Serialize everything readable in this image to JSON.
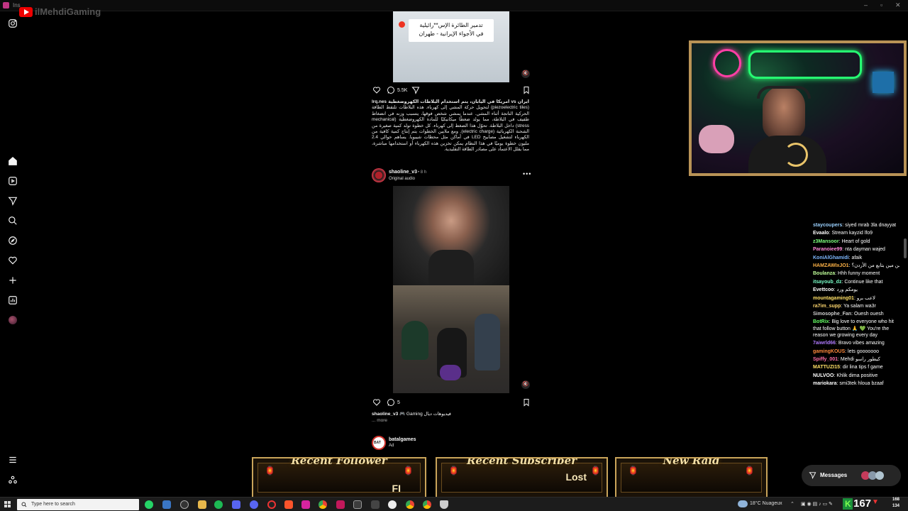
{
  "window": {
    "tab_title": "Ins"
  },
  "stream_badge": {
    "channel": "ilMehdiGaming"
  },
  "sidebar": {
    "icons": [
      "instagram-icon",
      "home-icon",
      "reels-icon",
      "send-icon",
      "search-icon",
      "explore-icon",
      "heart-icon",
      "create-icon",
      "dashboard-icon",
      "profile-icon",
      "menu-icon",
      "threads-icon"
    ]
  },
  "post1": {
    "image_text_line1": "تدمير الطائرة الإس**رائيلية",
    "image_text_line2": "في الأجواء الإيرانية - طهران",
    "comments": "5.5K",
    "caption_head": "ايران vs امريكا في اليابان، يتم استخدام البلاطات الكهروضغطية lrq.nes",
    "caption_body": "(piezoelectric tiles) لتحويل حركة المشي إلى كهرباء. هذه البلاطات تلتقط الطاقة الحركية الناتجة أثناء المشي. عندما يمشي شخص فوقها، يتسبب وزنه في انضغاط طفيف في البلاطة، مما يولد ضغطًا ميكانيكيًا للمادة الكهروضغطية (mechanical stress) داخل البلاطة. تحوّل هذا الضغط إلى كهرباء. كل خطوة تولد كمية صغيرة من الشحنة الكهربائية (electric charge). ومع ملايين الخطوات يتم إنتاج كمية كافية من الكهرباء لتشغيل مصابيح LED في أماكن مثل محطات شيبويا. يساهم حوالي 2.4 مليون خطوة يوميًا في هذا النظام يمكن تخزين هذه الكهرباء أو استخدامها مباشرة، مما يقلل الاعتماد على مصادر الطاقة التقليدية."
  },
  "post2": {
    "username": "shaoline_v3",
    "time": "• 8 h",
    "audio": "Original audio",
    "comments": "5",
    "caption_user": "shaoline_v3",
    "caption_text": "🎮 Gaming فيديوهات ديال",
    "more": "... more"
  },
  "post3": {
    "username": "batalgames",
    "label": "Ad",
    "avatar_text": "BAT"
  },
  "chat": [
    {
      "user": "staycoupers",
      "msg": "siyed mrab 3la dnayyat",
      "color": "#9ad1ff"
    },
    {
      "user": "Evaalo",
      "msg": "Stream kayzid lfo9",
      "color": "#ffffff"
    },
    {
      "user": "z3Mansoor",
      "msg": "Heart of gold",
      "color": "#7dff7d"
    },
    {
      "user": "Paranoiee99",
      "msg": "nta dayman wajed",
      "color": "#ff8ad8"
    },
    {
      "user": "KoniAlGhamidi",
      "msg": "afaik",
      "color": "#7fb8ff"
    },
    {
      "user": "HAMZAWIxJO1",
      "msg": "من مين بتابع من الأردن؟",
      "color": "#ffb347"
    },
    {
      "user": "Boulanza",
      "msg": "Hhh funny moment",
      "color": "#c0ff9a"
    },
    {
      "user": "itsayoub_dz",
      "msg": "Continue like that",
      "color": "#7affc9"
    },
    {
      "user": "Evettcoo",
      "msg": "يومكم ورد",
      "color": "#ffffff"
    },
    {
      "user": "mountagaming01",
      "msg": "لاعب برو",
      "color": "#ffe066"
    },
    {
      "user": "ra7im_supp",
      "msg": "Ya salam wa3r",
      "color": "#ffd76e"
    },
    {
      "user": "Simosophe_Fan",
      "msg": "Ouesh ouesh",
      "color": "#cfcfcf"
    },
    {
      "user": "BotRix",
      "msg": "Big love to everyone who hit that follow button 🙏 💚 You're the reason we growing every day",
      "color": "#66ff66"
    },
    {
      "user": "7aiwrld66",
      "msg": "Bravo vibes amazing",
      "color": "#b07bff"
    },
    {
      "user": "gamingKOUS",
      "msg": "lets gooooooo",
      "color": "#ff8a3d"
    },
    {
      "user": "Spiffy_001",
      "msg": "Mehdi كيطور راسو",
      "color": "#ff6fa8"
    },
    {
      "user": "MATTUZI15",
      "msg": "dir lina tips f game",
      "color": "#ffe066"
    },
    {
      "user": "NULVOO",
      "msg": "Khlik dima positive",
      "color": "#ffffff"
    },
    {
      "user": "mariokara",
      "msg": "smi3tek hloua bzaaf",
      "color": "#ffffff"
    }
  ],
  "alerts": [
    {
      "title": "Recent Follower",
      "value": "FI"
    },
    {
      "title": "Recent Subscriber",
      "value": "Lost"
    },
    {
      "title": "New Raid",
      "value": ""
    }
  ],
  "messages_label": "Messages",
  "taskbar": {
    "search_placeholder": "Type here to search",
    "weather": "18°C  Nuageux",
    "counter": "167",
    "counter_small_top": "168",
    "counter_small_bottom": "134"
  }
}
